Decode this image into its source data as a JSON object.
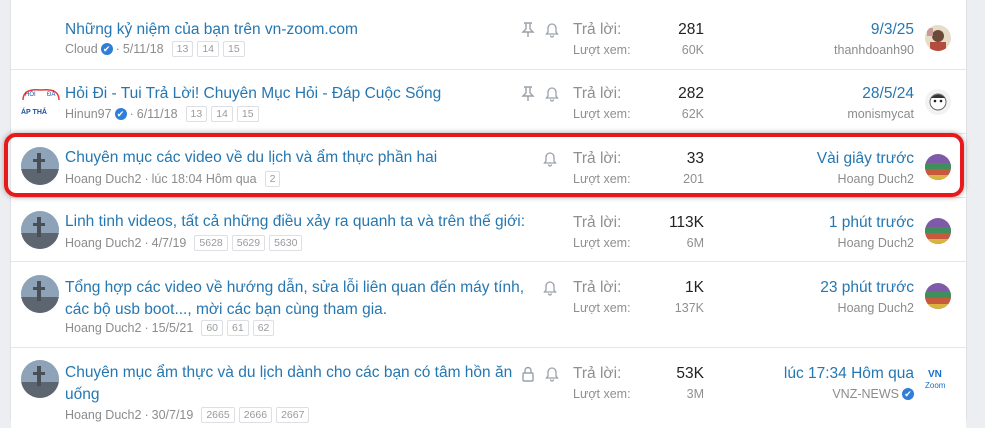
{
  "labels": {
    "replies": "Trả lời:",
    "views": "Lượt xem:"
  },
  "threads": [
    {
      "title": "Những kỷ niệm của bạn trên vn-zoom.com",
      "author": "Cloud",
      "author_verified": true,
      "date": "5/11/18",
      "pages": [
        "13",
        "14",
        "15"
      ],
      "icons": [
        "pin-icon",
        "bell-icon"
      ],
      "replies": "281",
      "views": "60K",
      "last_date": "9/3/25",
      "last_user": "thanhdoanh90"
    },
    {
      "title": "Hỏi Đi - Tui Trả Lời! Chuyên Mục Hỏi - Đáp Cuộc Sống",
      "author": "Hinun97",
      "author_verified": true,
      "date": "6/11/18",
      "pages": [
        "13",
        "14",
        "15"
      ],
      "icons": [
        "pin-icon",
        "bell-icon"
      ],
      "replies": "282",
      "views": "62K",
      "last_date": "28/5/24",
      "last_user": "monismycat",
      "avatar_text": [
        "HỎI",
        "ĐÁ",
        "ÁP THẮ"
      ]
    },
    {
      "title": "Chuyên mục các video về du lịch và ẩm thực phần hai",
      "author": "Hoang Duch2",
      "date": "lúc 18:04 Hôm qua",
      "pages": [
        "2"
      ],
      "icons": [
        "bell-icon"
      ],
      "replies": "33",
      "views": "201",
      "last_date": "Vài giây trước",
      "last_user": "Hoang Duch2"
    },
    {
      "title": "Linh tinh videos, tất cả những điều xảy ra quanh ta và trên thế giới:",
      "author": "Hoang Duch2",
      "date": "4/7/19",
      "pages": [
        "5628",
        "5629",
        "5630"
      ],
      "icons": [],
      "replies": "113K",
      "views": "6M",
      "last_date": "1 phút trước",
      "last_user": "Hoang Duch2"
    },
    {
      "title": "Tổng hợp các video về hướng dẫn, sửa lỗi liên quan đến máy tính, các bộ usb boot..., mời các bạn cùng tham gia.",
      "author": "Hoang Duch2",
      "date": "15/5/21",
      "pages": [
        "60",
        "61",
        "62"
      ],
      "icons": [
        "bell-icon"
      ],
      "replies": "1K",
      "views": "137K",
      "last_date": "23 phút trước",
      "last_user": "Hoang Duch2"
    },
    {
      "title": "Chuyên mục ẩm thực và du lịch dành cho các bạn có tâm hồn ăn uống",
      "author": "Hoang Duch2",
      "date": "30/7/19",
      "pages": [
        "2665",
        "2666",
        "2667"
      ],
      "icons": [
        "lock-icon",
        "bell-icon"
      ],
      "replies": "53K",
      "views": "3M",
      "last_date": "lúc 17:34 Hôm qua",
      "last_user": "VNZ-NEWS",
      "last_user_verified": true,
      "last_avatar_text": [
        "VN",
        "Zoom"
      ]
    }
  ],
  "colors": {
    "link": "#2577b1",
    "highlight": "#e8191a",
    "muted": "#8c8c8c"
  }
}
